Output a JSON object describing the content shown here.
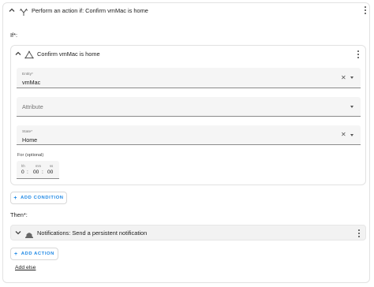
{
  "header": {
    "title": "Perform an action if: Confirm vmMac is home"
  },
  "if_section": {
    "label": "If*:",
    "condition": {
      "title": "Confirm vmMac is home",
      "entity": {
        "label": "Entity*",
        "value": "vmMac"
      },
      "attribute": {
        "label": "Attribute"
      },
      "state": {
        "label": "State*",
        "value": "Home"
      },
      "for": {
        "label": "For (optional)",
        "units": {
          "hh": "hh",
          "mm": "mm",
          "ss": "ss"
        },
        "values": {
          "hh": "0",
          "mm": "00",
          "ss": "00"
        }
      }
    },
    "add_condition_label": "ADD CONDITION"
  },
  "then_section": {
    "label": "Then*:",
    "action_title": "Notifications: Send a persistent notification",
    "add_action_label": "ADD ACTION"
  },
  "add_else_label": "Add else",
  "icons": {
    "chevron": "chevron-icon",
    "choose": "branch-icon",
    "condition": "triangle-icon",
    "notify": "bell-icon",
    "menu": "kebab-icon"
  },
  "colors": {
    "accent": "#1e88e5",
    "border": "#e2e2e2",
    "field": "#f5f5f5"
  }
}
